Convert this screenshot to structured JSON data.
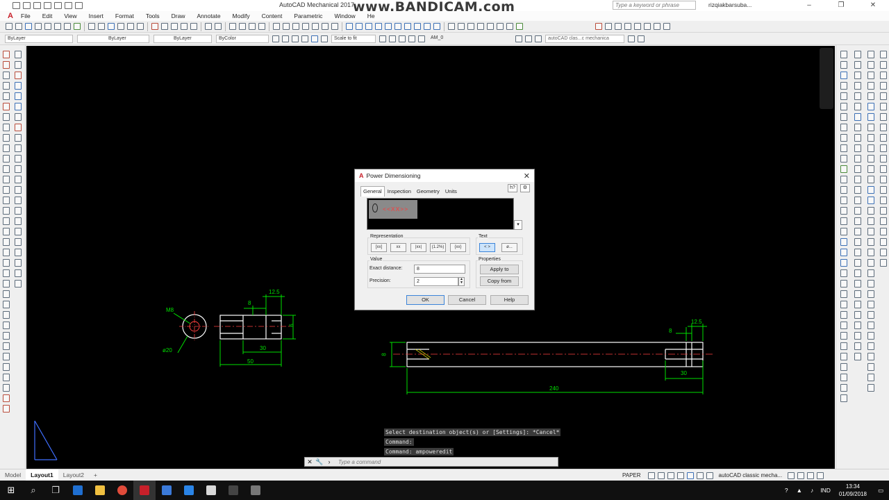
{
  "titlebar": {
    "app_title": "AutoCAD Mechanical 2017",
    "overlay": "www.BANDICAM.com",
    "search_placeholder": "Type a keyword or phrase",
    "user": "rizqiakbarsuba..."
  },
  "menu": [
    "File",
    "Edit",
    "View",
    "Insert",
    "Format",
    "Tools",
    "Draw",
    "Annotate",
    "Modify",
    "Content",
    "Parametric",
    "Window",
    "He"
  ],
  "toolbar2": {
    "layer1": "ByLayer",
    "linetype": "ByLayer",
    "lineweight": "ByLayer",
    "color": "ByColor",
    "scale": "Scale to fit",
    "layer_am": "AM_0",
    "workspace": "autoCAD clas...c mechanica"
  },
  "drawing": {
    "dim_12_5_left": "12.5",
    "dim_8_left": "8",
    "m8": "M8",
    "dim_6": "6",
    "phi20": "ø20",
    "dim_30_left": "30",
    "dim_50": "50",
    "dim_8_right": "8",
    "dim_12_5_right": "12.5",
    "dim_8_vert": "8",
    "dim_30_right": "30",
    "dim_240": "240",
    "colors": {
      "dimension": "#00e000",
      "outline": "#ffffff",
      "center": "#ff4040"
    }
  },
  "command": {
    "history": [
      "Select destination object(s) or [Settings]: *Cancel*",
      "Command:",
      "Command: ampoweredit"
    ],
    "placeholder": "Type a command"
  },
  "tabs": [
    "Model",
    "Layout1",
    "Layout2"
  ],
  "status": {
    "paper": "PAPER",
    "workspace": "autoCAD classic mecha...",
    "lang": "IND",
    "time": "13:34",
    "date": "01/09/2018"
  },
  "dialog": {
    "title": "Power Dimensioning",
    "tabs": [
      "General",
      "Inspection",
      "Geometry",
      "Units"
    ],
    "help_icon": "h?",
    "editor_text": "<<XX>>",
    "representation_label": "Representation",
    "representation_buttons": [
      "[xx]",
      "xx",
      "|xx|",
      "(1.2%)",
      "{xx}"
    ],
    "text_label": "Text",
    "text_buttons": [
      "< >",
      "ø..."
    ],
    "value_label": "Value",
    "exact_distance_label": "Exact distance:",
    "exact_distance_value": "8",
    "precision_label": "Precision:",
    "precision_value": "2",
    "properties_label": "Properties",
    "apply_to": "Apply to",
    "copy_from": "Copy from",
    "ok": "OK",
    "cancel": "Cancel",
    "help": "Help"
  }
}
